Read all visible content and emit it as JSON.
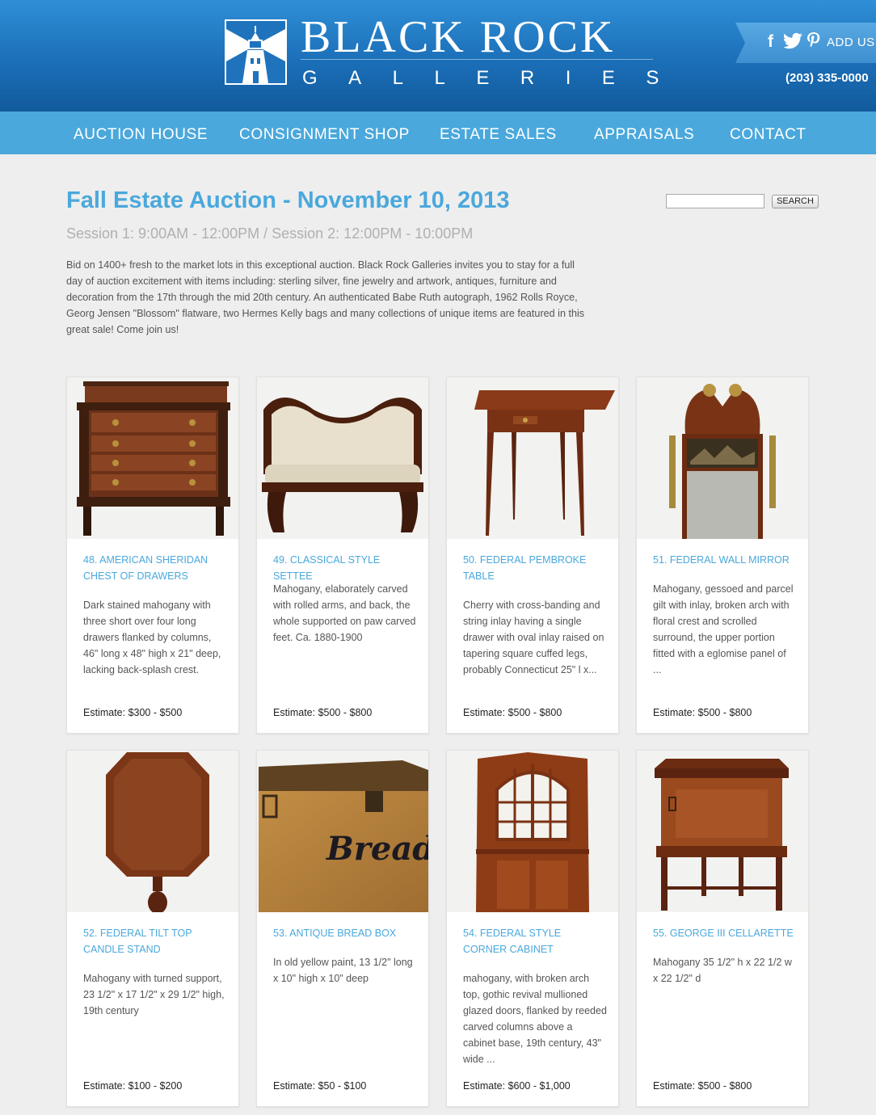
{
  "header": {
    "logo_line1": "BLACK ROCK",
    "logo_line2": "GALLERIES",
    "social": {
      "add_us": "ADD US"
    },
    "phone": "(203) 335-0000",
    "colors": {
      "header": "#1b6fb8",
      "nav": "#4aa8dc",
      "accent": "#4aa8dc"
    }
  },
  "nav": {
    "items": [
      "AUCTION HOUSE",
      "CONSIGNMENT SHOP",
      "ESTATE SALES",
      "APPRAISALS",
      "CONTACT"
    ]
  },
  "main": {
    "title": "Fall Estate Auction - November 10, 2013",
    "session": "Session 1: 9:00AM - 12:00PM / Session 2: 12:00PM - 10:00PM",
    "intro": "Bid on 1400+ fresh to the market lots in this exceptional auction. Black Rock Galleries invites you to stay for a full day of auction excitement with items including: sterling silver, fine jewelry and artwork, antiques, furniture and decoration from the 17th through the mid 20th century. An authenticated Babe Ruth autograph, 1962 Rolls Royce, Georg Jensen \"Blossom\" flatware, two Hermes Kelly bags and many collections of unique items are featured in this great sale! Come join us!"
  },
  "search": {
    "button": "SEARCH",
    "value": ""
  },
  "lots": [
    {
      "title": "48. AMERICAN SHERIDAN CHEST OF DRAWERS",
      "desc": "Dark stained mahogany with three short over four long drawers flanked by columns, 46\" long x 48\" high x 21\" deep, lacking back-splash crest.",
      "estimate": "Estimate: $300 - $500"
    },
    {
      "title": "49. CLASSICAL STYLE SETTEE",
      "desc": "Mahogany, elaborately carved with rolled arms, and back, the whole supported on paw carved feet. Ca. 1880-1900",
      "estimate": "Estimate: $500 - $800"
    },
    {
      "title": "50. FEDERAL PEMBROKE TABLE",
      "desc": "Cherry with cross-banding and string inlay having a single drawer with oval inlay raised on tapering square cuffed legs, probably Connecticut 25\" l x...",
      "estimate": "Estimate: $500 - $800"
    },
    {
      "title": "51. FEDERAL WALL MIRROR",
      "desc": "Mahogany, gessoed and parcel gilt with inlay, broken arch with floral crest and scrolled surround, the upper portion fitted with a eglomise panel of ...",
      "estimate": "Estimate: $500 - $800"
    },
    {
      "title": "52. FEDERAL TILT TOP CANDLE STAND",
      "desc": "Mahogany with turned support, 23 1/2\" x 17 1/2\" x 29 1/2\" high, 19th century",
      "estimate": "Estimate: $100 - $200"
    },
    {
      "title": "53. ANTIQUE BREAD BOX",
      "desc": "In old yellow paint, 13 1/2\" long x 10\" high x 10\" deep",
      "estimate": "Estimate: $50 - $100",
      "img_text": "Bread"
    },
    {
      "title": "54. FEDERAL STYLE CORNER CABINET",
      "desc": "mahogany, with broken arch top, gothic revival mullioned glazed doors, flanked by reeded carved columns above a cabinet base, 19th century, 43\" wide ...",
      "estimate": "Estimate: $600 - $1,000"
    },
    {
      "title": "55. GEORGE III CELLARETTE",
      "desc": "Mahogany 35 1/2\" h x 22 1/2 w x 22 1/2\" d",
      "estimate": "Estimate: $500 - $800"
    }
  ]
}
